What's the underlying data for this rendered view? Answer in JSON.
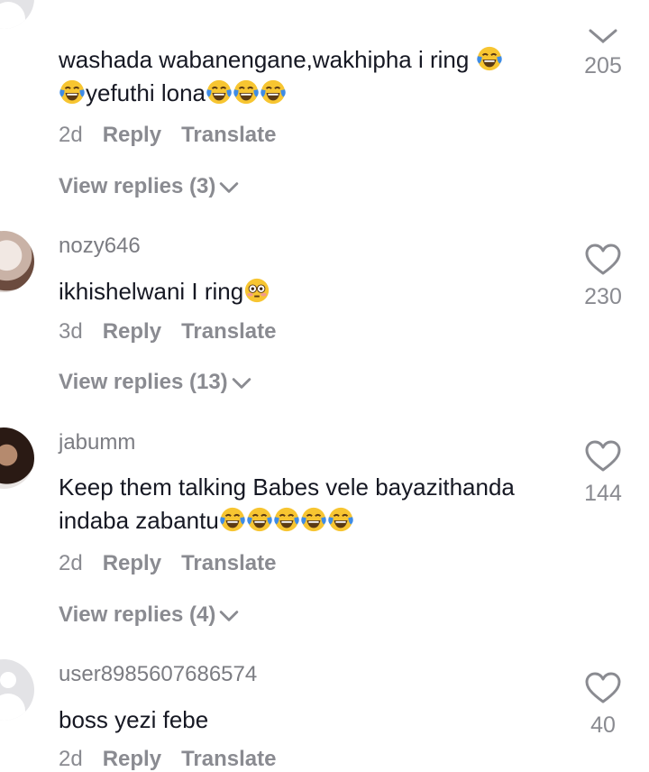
{
  "icons": {
    "laugh_emoji": "face-with-tears-of-joy",
    "flushed_emoji": "flushed-face",
    "like": "heart-outline-icon",
    "expand": "chevron-down-icon"
  },
  "colors": {
    "text": "#161823",
    "secondary": "#8a8b91",
    "username": "#7b7c82"
  },
  "comments": [
    {
      "username": "",
      "text_a": "washada wabanengane,wakhipha i ring ",
      "text_b": "yefuthi lona",
      "age": "2d",
      "reply": "Reply",
      "translate": "Translate",
      "view_replies": "View replies (3)",
      "likes": "205"
    },
    {
      "username": "nozy646",
      "text": "ikhishelwani I ring",
      "age": "3d",
      "reply": "Reply",
      "translate": "Translate",
      "view_replies": "View replies (13)",
      "likes": "230"
    },
    {
      "username": "jabumm",
      "text_a": "Keep them talking Babes vele bayazithanda",
      "text_b": "indaba zabantu",
      "age": "2d",
      "reply": "Reply",
      "translate": "Translate",
      "view_replies": "View replies (4)",
      "likes": "144"
    },
    {
      "username": "user8985607686574",
      "text": "boss yezi febe",
      "age": "2d",
      "reply": "Reply",
      "translate": "Translate",
      "likes": "40"
    }
  ]
}
